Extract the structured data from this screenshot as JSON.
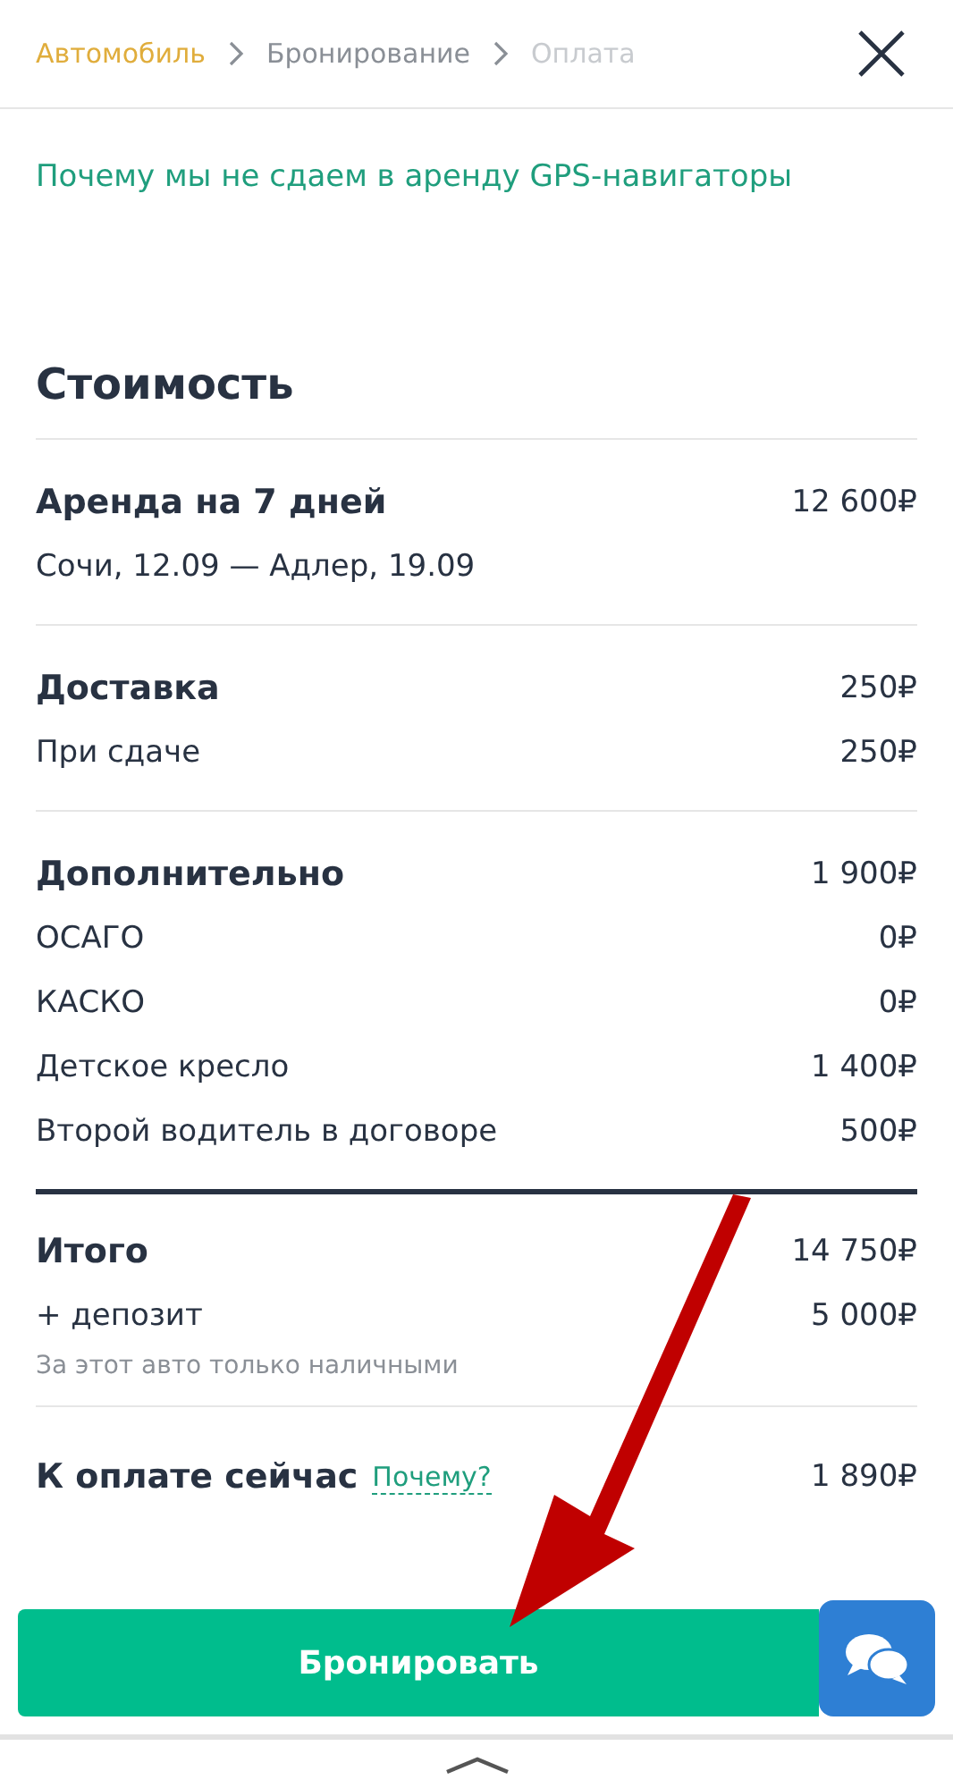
{
  "breadcrumbs": [
    {
      "label": "Автомобиль",
      "kind": "done"
    },
    {
      "label": "Бронирование",
      "kind": "current"
    },
    {
      "label": "Оплата",
      "kind": "upcoming"
    }
  ],
  "gps_link": "Почему мы не сдаем в аренду GPS-навигаторы",
  "cost": {
    "title": "Стоимость",
    "sections": [
      {
        "kind": "group",
        "title": "Аренда на 7 дней",
        "amount": "12 600₽",
        "items": [
          {
            "label": "Сочи, 12.09 — Адлер, 19.09"
          }
        ]
      },
      {
        "kind": "group",
        "title": "Доставка",
        "amount": "250₽",
        "items": [
          {
            "label": "При сдаче",
            "amount": "250₽"
          }
        ]
      },
      {
        "kind": "group",
        "title": "Дополнительно",
        "amount": "1 900₽",
        "items": [
          {
            "label": "ОСАГО",
            "amount": "0₽"
          },
          {
            "label": "КАСКО",
            "amount": "0₽"
          },
          {
            "label": "Детское кресло",
            "amount": "1 400₽"
          },
          {
            "label": "Второй водитель в договоре",
            "amount": "500₽"
          }
        ]
      },
      {
        "kind": "summary",
        "title": "Итого",
        "amount": "14 750₽",
        "items": [
          {
            "label": "+ депозит",
            "amount": "5 000₽"
          }
        ],
        "note": "За этот авто только наличными"
      }
    ],
    "pay_now": {
      "label": "К оплате сейчас",
      "link": "Почему?",
      "amount": "1 890₽"
    }
  },
  "book_button": "Бронировать"
}
